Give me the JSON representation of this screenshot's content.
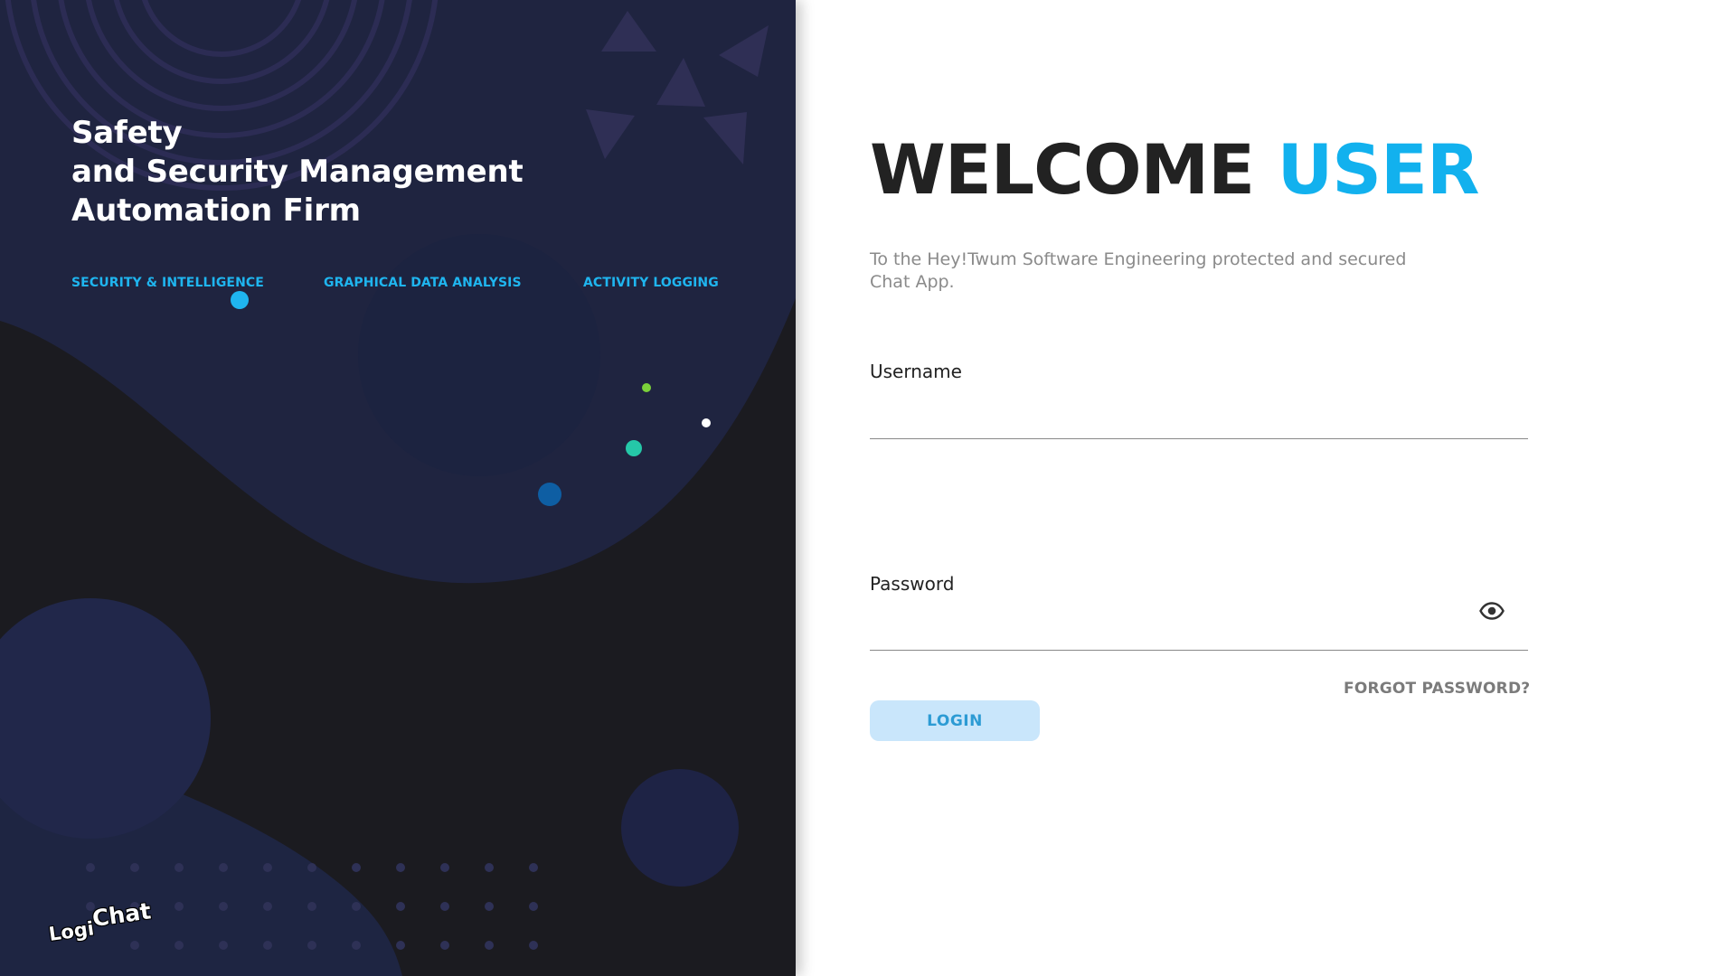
{
  "left_panel": {
    "title_lines": [
      "Safety",
      "and Security Management",
      "Automation Firm"
    ],
    "features": [
      "SECURITY & INTELLIGENCE",
      "GRAPHICAL DATA ANALYSIS",
      "ACTIVITY LOGGING"
    ],
    "logo": {
      "part1": "Logi",
      "part2": "Chat"
    }
  },
  "login": {
    "welcome_word": "WELCOME",
    "welcome_highlight": "USER",
    "subtitle": "To the Hey!Twum Software Engineering protected and secured Chat App.",
    "username_label": "Username",
    "username_value": "",
    "password_label": "Password",
    "password_value": "",
    "forgot_label": "FORGOT PASSWORD?",
    "login_label": "LOGIN"
  },
  "colors": {
    "accent": "#12b1ee",
    "panel_dark": "#1b1b20",
    "panel_navy": "#1f2440",
    "login_button_bg": "#c9e6fb",
    "login_button_text": "#2c9bd4"
  },
  "icons": {
    "password_toggle": "eye-icon"
  }
}
